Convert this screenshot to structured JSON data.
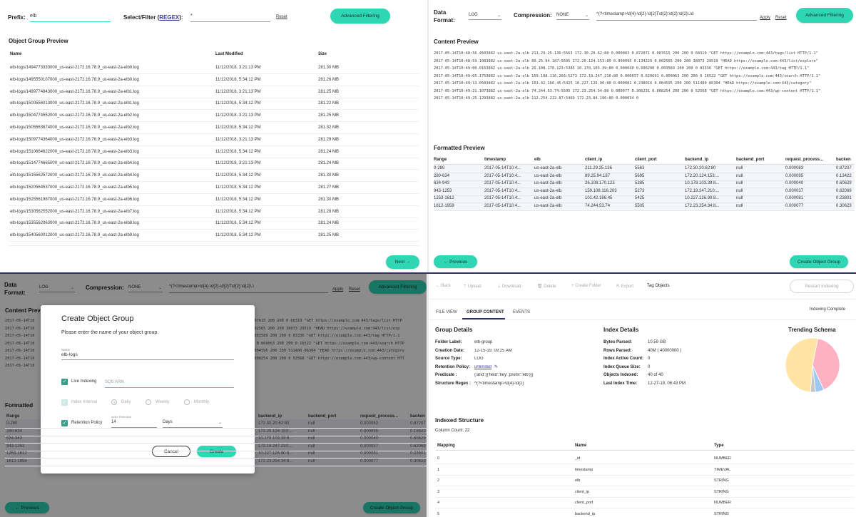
{
  "q1": {
    "prefix_label": "Prefix:",
    "prefix_value": "elb",
    "filter_label": "Select/Filter (",
    "filter_regex": "REGEX",
    "filter_close": "):",
    "filter_value": "*",
    "reset": "Reset",
    "advanced": "Advanced Filtering",
    "section_title": "Object Group Preview",
    "columns": [
      "Name",
      "Last Modified",
      "Size"
    ],
    "rows": [
      [
        "elb-logs/1494773333000_us-east-2172.16.78.9_us-east-2a-elb0.log",
        "11/12/2018, 3:21:13 PM",
        "281.30 MB"
      ],
      [
        "elb-logs/1495550107000_us-east-2172.16.78.9_us-east-2a-elb0.log",
        "11/12/2018, 5:34:12 PM",
        "281.26 MB"
      ],
      [
        "elb-logs/1499774843000_us-east-2172.16.78.9_us-east-2a-elb1.log",
        "11/12/2018, 3:21:13 PM",
        "281.25 MB"
      ],
      [
        "elb-logs/1500556013000_us-east-2172.16.78.9_us-east-2a-elb1.log",
        "11/12/2018, 5:34:12 PM",
        "281.22 MB"
      ],
      [
        "elb-logs/1504774552000_us-east-2172.16.78.9_us-east-2a-elb2.log",
        "11/12/2018, 3:21:13 PM",
        "281.25 MB"
      ],
      [
        "elb-logs/1505563674000_us-east-2172.16.78.9_us-east-2a-elb2.log",
        "11/12/2018, 5:34:12 PM",
        "281.32 MB"
      ],
      [
        "elb-logs/1509774364000_us-east-2172.16.78.9_us-east-2a-elb3.log",
        "11/12/2018, 3:21:13 PM",
        "281.29 MB"
      ],
      [
        "elb-logs/1510664622000_us-east-2172.16.78.9_us-east-2a-elb3.log",
        "11/12/2018, 5:34:12 PM",
        "281.24 MB"
      ],
      [
        "elb-logs/1514774665000_us-east-2172.16.78.9_us-east-2a-elb4.log",
        "11/12/2018, 3:21:13 PM",
        "281.24 MB"
      ],
      [
        "elb-logs/1515562572000_us-east-2172.16.78.9_us-east-2a-elb4.log",
        "11/12/2018, 5:34:12 PM",
        "281.30 MB"
      ],
      [
        "elb-logs/1520564537000_us-east-2172.16.78.9_us-east-2a-elb5.log",
        "11/12/2018, 5:34:12 PM",
        "281.27 MB"
      ],
      [
        "elb-logs/1525561987000_us-east-2172.16.78.9_us-east-2a-elb6.log",
        "11/12/2018, 5:34:12 PM",
        "281.30 MB"
      ],
      [
        "elb-logs/1530562552000_us-east-2172.16.78.9_us-east-2a-elb7.log",
        "11/12/2018, 5:34:12 PM",
        "281.28 MB"
      ],
      [
        "elb-logs/1535562063000_us-east-2172.16.78.9_us-east-2a-elb8.log",
        "11/12/2018, 5:34:12 PM",
        "281.24 MB"
      ],
      [
        "elb-logs/1540560012000_us-east-2172.16.78.9_us-east-2a-elb9.log",
        "11/12/2018, 5:34:12 PM",
        "281.25 MB"
      ]
    ],
    "next": "Next →"
  },
  "q2": {
    "data_format_label": "Data Format:",
    "data_format_value": "LOG",
    "compression_label": "Compression:",
    "compression_value": "NONE",
    "regex_value": "^(?<timestamp>\\d{4}-\\d{2}-\\d{2}T\\d{2}:\\d{2}:\\d{2}\\.\\d",
    "apply": "Apply",
    "reset": "Reset",
    "advanced": "Advanced Filtering",
    "content_title": "Content Preview",
    "content_lines": [
      "2017-05-14T10:48:56.4503882 us-east-2a-elb 211.29.25.136:5563 172.30.20.62:80 0.000083 0.872071 0.007615 200 200 0 60319 \"GET https://example.com:443/tags/list HTTP/1.1\"",
      "2017-05-14T10:48:59.1083882 us-east-2a-elb 89.25.94.187:5695 172.20.124.153:80 0.000095 0.134229 0.002565 200 200 38073 29519 \"HEAD https://example.com:443/list/explore\"",
      "2017-05-14T10:49:00.0163882 us-east-2a-elb 26.108.170.123:5385 10.178.103.39:80 0.000040 0.606290 0.003589 200 200 0 83336 \"GET https://example.com:443/tag HTTP/1.1\"",
      "2017-05-14T10:49:05.1753882 us-east-2a-elb 159.108.116.203:5273 172.19.247.210:80 0.000037 0.620691 0.009063 200 200 0 16522 \"GET https://example.com:443/search HTTP/1.1\"",
      "2017-05-14T10:49:13.0503882 us-east-2a-elb 101.42.166.45:5425 10.227.126.90:80 0.000081 0.238016 0.004595 200 200 511480 86304 \"HEAD https://example.com:443/category\"",
      "2017-05-14T10:49:21.1073882 us-east-2a-elb 74.244.53.74:5505 172.23.254.34:80 0.000077 0.306231 0.008254 200 200 0 52568 \"GET https://example.com:443/wp-content HTTP/1.1\"",
      "2017-05-14T10:49:25.1293882 us-east-2a-elb 112.254.222.87:5469 172.23.84.196:80 0.000034 0"
    ],
    "formatted_title": "Formatted Preview",
    "f_columns": [
      "Range",
      "timestamp",
      "elb",
      "client_ip",
      "client_port",
      "backend_ip",
      "backend_port",
      "request_process...",
      "backen"
    ],
    "f_rows": [
      [
        "0-280",
        "2017-05-14T10:4...",
        "us-east-2a-elb",
        "211.29.25.136",
        "5563",
        "172.30.20.62:80",
        "null",
        "0.000083",
        "0.87207"
      ],
      [
        "280-634",
        "2017-05-14T10:4...",
        "us-east-2a-elb",
        "89.25.94.187",
        "5695",
        "172.20.124.153:...",
        "null",
        "0.000095",
        "0.13422"
      ],
      [
        "634-943",
        "2017-05-14T10:4...",
        "us-east-2a-elb",
        "26.108.170.123",
        "5385",
        "10.178.103.39:8...",
        "null",
        "0.000040",
        "0.60629"
      ],
      [
        "943-1253",
        "2017-05-14T10:4...",
        "us-east-2a-elb",
        "159.108.116.203",
        "5273",
        "172.19.247.210:...",
        "null",
        "0.000037",
        "0.62069"
      ],
      [
        "1253-1612",
        "2017-05-14T10:4...",
        "us-east-2a-elb",
        "101.42.166.45",
        "5425",
        "10.227.126.90:8...",
        "null",
        "0.000081",
        "0.23801"
      ],
      [
        "1612-1959",
        "2017-05-14T10:4...",
        "us-east-2a-elb",
        "74.244.53.74",
        "5505",
        "172.23.254.34:8...",
        "null",
        "0.000077",
        "0.30623"
      ]
    ],
    "previous": "← Previous",
    "create": "Create Object Group"
  },
  "q3": {
    "data_format_label": "Data Format:",
    "data_format_value": "LOG",
    "compression_label": "Compression:",
    "compression_value": "NONE",
    "regex_value": "^(?<timestamp>\\d{4}-\\d{2}-\\d{2}T\\d{2}:\\d{2}\\.\\",
    "apply": "Apply",
    "reset": "Reset",
    "advanced": "Advanced Filtering",
    "content_title": "Content Preview",
    "bg_lines_left": [
      "2017-05-14T10",
      "2017-05-14T10",
      "2017-05-14T10",
      "2017-05-14T10",
      "2017-05-14T10",
      "2017-05-14T10",
      "2017-05-14T10"
    ],
    "bg_lines_right": [
      ".007615 200 200 0 60319 \"GET https://example.com:443/tags/list HTTP",
      ".002565 200 200 38073 29519 \"HEAD https://example.com:443/list/exp",
      "0.003589 200 200 0 83336 \"GET https://example.com:443/tag HTTP/1.1",
      "91 0.009063 200 200 0 16522 \"GET https://example.com:443/search HTTP",
      "0.004595 200 200 511480 86304 \"HEAD https://example.com:443/category",
      "0.008254 200 200 0 52568 \"GET https://example.com:443/wp-content HTT",
      ""
    ],
    "formatted_title": "Formatted",
    "f_left_header": "Range",
    "f_left": [
      "0-280",
      "280-634",
      "634-943",
      "943-1253",
      "1253-1612",
      "1612-1959"
    ],
    "f_right_columns": [
      "backend_ip",
      "backend_port",
      "request_process...",
      "backen"
    ],
    "f_right": [
      [
        "172.30.20.62:80",
        "null",
        "0.000083",
        "0.87207"
      ],
      [
        "172.20.124.153:...",
        "null",
        "0.000095",
        "0.13422"
      ],
      [
        "10.178.103.39:8...",
        "null",
        "0.000040",
        "0.60629"
      ],
      [
        "172.19.247.210:...",
        "null",
        "0.000037",
        "0.62069"
      ],
      [
        "10.227.126.90:8...",
        "null",
        "0.000081",
        "0.23801"
      ],
      [
        "172.23.254.34:8...",
        "null",
        "0.000077",
        "0.30623"
      ]
    ],
    "previous": "← Previous",
    "create": "Create Object Group",
    "modal": {
      "title": "Create Object Group",
      "subtitle": "Please enter the name of your object group.",
      "name_label": "Name",
      "name_value": "elb-logs",
      "live_indexing": "Live Indexing",
      "sqs_placeholder": "SQS ARN",
      "index_interval": "Index Interval",
      "interval_options": [
        "Daily",
        "Weekly",
        "Monthly"
      ],
      "retention_policy": "Retention Policy",
      "retention_sublabel": "Index Retention",
      "retention_value": "14",
      "retention_unit": "Days",
      "cancel": "Cancel",
      "create": "Create"
    }
  },
  "q4": {
    "toolbar": [
      "← Back",
      "⇡ Upload",
      "⇣ Download",
      "🗑 Delete",
      "+ Create Folder",
      "⇱ Export",
      "Tag Objects"
    ],
    "restart": "Restart Indexing",
    "tabs": [
      "FILE VIEW",
      "GROUP CONTENT",
      "EVENTS"
    ],
    "indexing_status": "Indexing Complete",
    "group_details_title": "Group Details",
    "group_details": [
      [
        "Folder Label:",
        "elb-group"
      ],
      [
        "Creation Date:",
        "12-15-19, 09:25 AM"
      ],
      [
        "Source Type:",
        "LOG"
      ],
      [
        "Retention Policy:",
        "unlimited"
      ],
      [
        "Predicate :",
        "{'and':[{'field':'key','prefix':'elb'}]}"
      ],
      [
        "Structure Regex :",
        "^(?<timestamp>\\d{4}-\\d{2}"
      ]
    ],
    "index_details_title": "Index Details",
    "index_details": [
      [
        "Bytes Parsed:",
        "10.59 GB"
      ],
      [
        "Rows Parsed:",
        "40M ( 40000000 )"
      ],
      [
        "Index Active Count:",
        "0"
      ],
      [
        "Index Queue Size:",
        "0"
      ],
      [
        "Objects Indexed:",
        "40 of 40"
      ],
      [
        "Last Index Time:",
        "12-27-19, 06:43 PM"
      ]
    ],
    "trending_title": "Trending Schema",
    "pie_values": [
      40,
      5,
      3,
      52
    ],
    "pie_colors": [
      "#ffb0c1",
      "#9cc9f2",
      "#c6c6c6",
      "#ffe4a6"
    ],
    "indexed_title": "Indexed Structure",
    "column_count": "Column Count: 22",
    "columns": [
      "Mapping",
      "Name",
      "Type"
    ],
    "rows": [
      [
        "0",
        "_id",
        "NUMBER"
      ],
      [
        "1",
        "timestamp",
        "TIMEVAL"
      ],
      [
        "2",
        "elb",
        "STRING"
      ],
      [
        "3",
        "client_ip",
        "STRING"
      ],
      [
        "4",
        "client_port",
        "NUMBER"
      ],
      [
        "5",
        "backend_ip",
        "STRING"
      ]
    ]
  },
  "colors": {
    "accent": "#2fd6b4",
    "divider": "#2b2f6b",
    "link": "#3b3fa6",
    "check": "#3a9d8c"
  }
}
